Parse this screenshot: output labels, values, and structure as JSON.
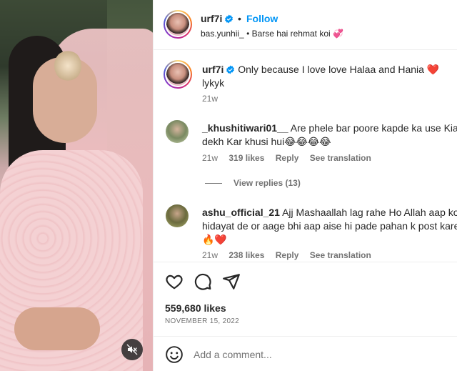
{
  "post": {
    "username": "urf7i",
    "follow_label": "Follow",
    "separator": "•",
    "audio_account": "bas.yunhii_",
    "audio_separator": "•",
    "audio_title": "Barse hai rehmat koi 💞",
    "caption": {
      "username": "urf7i",
      "text": "Only because I love love Halaa and Hania ❤️",
      "text_line2": "lykyk",
      "time": "21w"
    }
  },
  "comments": [
    {
      "username": "_khushitiwari01__",
      "text_line1": "Are phele bar poore kapde ka use Kia hai",
      "text_line2": "dekh Kar khusi hui😂😂😂😂",
      "time": "21w",
      "likes": "319 likes",
      "reply_label": "Reply",
      "translate_label": "See translation",
      "view_replies": "View replies (13)"
    },
    {
      "username": "ashu_official_21",
      "text_line1": "Ajj Mashaallah lag rahe Ho Allah aap ko sab",
      "text_line2": "hidayat de or aage bhi aap aise hi pade pahan k post kare",
      "text_line3": "🔥❤️",
      "time": "21w",
      "likes": "238 likes",
      "reply_label": "Reply",
      "translate_label": "See translation"
    }
  ],
  "footer": {
    "likes_count": "559,680 likes",
    "date": "NOVEMBER 15, 2022",
    "comment_placeholder": "Add a comment..."
  },
  "icons": {
    "like": "heart-icon",
    "comment": "comment-icon",
    "share": "share-icon",
    "emoji": "emoji-icon",
    "mute": "muted-speaker-icon",
    "verified": "verified-badge-icon"
  },
  "colors": {
    "accent": "#0095f6",
    "text": "#262626",
    "secondary_text": "#737373",
    "heart_red": "#ed4956"
  }
}
